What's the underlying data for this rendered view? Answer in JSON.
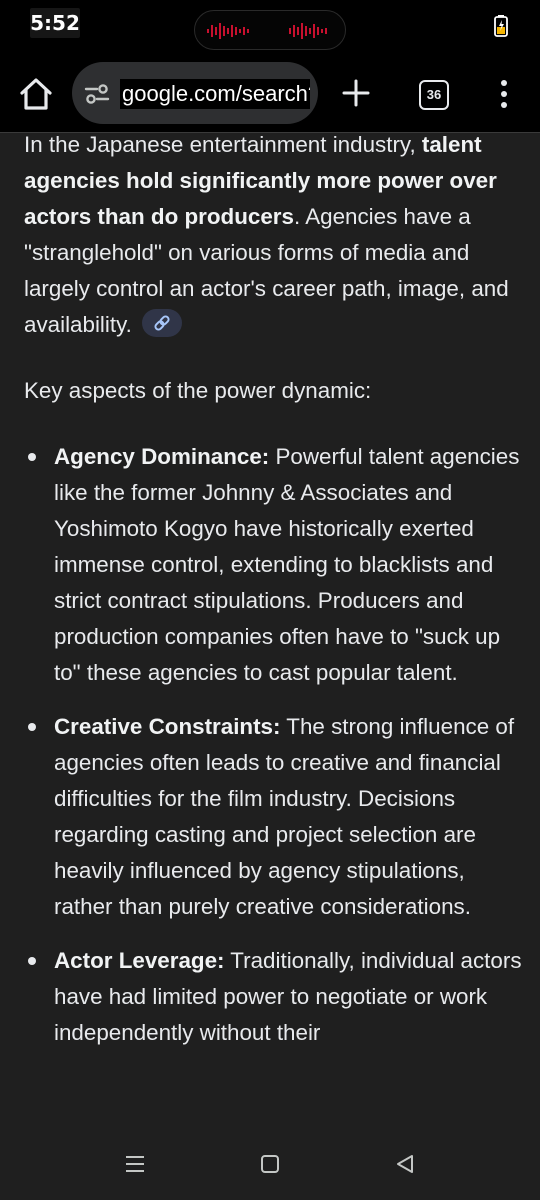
{
  "status_bar": {
    "time": "5:52",
    "battery_icon": "battery-charging-icon"
  },
  "browser": {
    "url": "google.com/search?",
    "tab_count": "36",
    "icons": [
      "home-icon",
      "site-settings-icon",
      "plus-icon",
      "tab-switcher-icon",
      "more-vert-icon"
    ]
  },
  "content": {
    "intro": {
      "part1": "In the Japanese entertainment industry, ",
      "bold": "talent agencies hold significantly more power over actors than do producers",
      "part2": ". Agencies have a \"stranglehold\" on various forms of media and largely control an actor's career path, image, and availability."
    },
    "subheading": "Key aspects of the power dynamic:",
    "bullets": [
      {
        "title": "Agency Dominance:",
        "text": " Powerful talent agencies like the former Johnny & Associates and Yoshimoto Kogyo have historically exerted immense control, extending to blacklists and strict contract stipulations. Producers and production companies often have to \"suck up to\" these agencies to cast popular talent."
      },
      {
        "title": "Creative Constraints:",
        "text": " The strong influence of agencies often leads to creative and financial difficulties for the film industry. Decisions regarding casting and project selection are heavily influenced by agency stipulations, rather than purely creative considerations."
      },
      {
        "title": "Actor Leverage:",
        "text": " Traditionally, individual actors have had limited power to negotiate or work independently without their"
      }
    ]
  },
  "nav_bar": {
    "icons": [
      "recents-icon",
      "home-nav-icon",
      "back-icon"
    ]
  },
  "colors": {
    "background": "#1f1f1f",
    "toolbar": "#000000",
    "text": "#e8eaed",
    "chip": "#303548",
    "chip_icon": "#a8c7fa"
  }
}
